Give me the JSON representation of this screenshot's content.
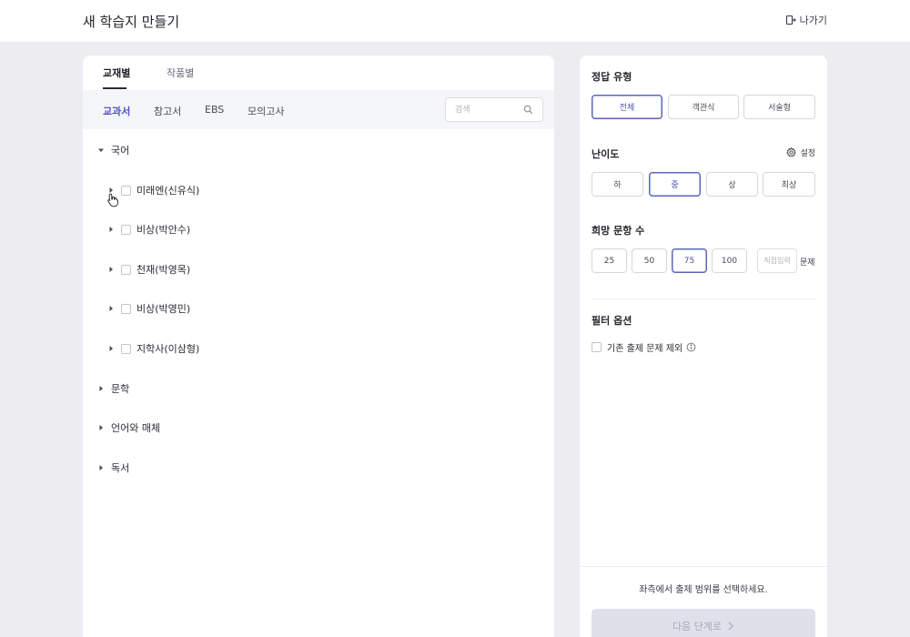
{
  "header": {
    "title": "새 학습지 만들기",
    "exit_label": "나가기"
  },
  "left": {
    "main_tabs": [
      {
        "label": "교재별"
      },
      {
        "label": "작품별"
      }
    ],
    "sub_tabs": [
      {
        "label": "교과서"
      },
      {
        "label": "참고서"
      },
      {
        "label": "EBS"
      },
      {
        "label": "모의고사"
      }
    ],
    "search": {
      "placeholder": "검색",
      "value": ""
    },
    "tree": {
      "root": {
        "label": "국어"
      },
      "children": [
        {
          "label": "미래엔(신유식)"
        },
        {
          "label": "비상(박안수)"
        },
        {
          "label": "천재(박영목)"
        },
        {
          "label": "비상(박영민)"
        },
        {
          "label": "지학사(이삼형)"
        }
      ],
      "siblings": [
        {
          "label": "문학"
        },
        {
          "label": "언어와 매체"
        },
        {
          "label": "독서"
        }
      ]
    }
  },
  "right": {
    "answer_type": {
      "title": "정답 유형",
      "options": [
        {
          "label": "전체"
        },
        {
          "label": "객관식"
        },
        {
          "label": "서술형"
        }
      ],
      "selected": "전체"
    },
    "difficulty": {
      "title": "난이도",
      "settings_label": "설정",
      "options": [
        {
          "label": "하"
        },
        {
          "label": "중"
        },
        {
          "label": "상"
        },
        {
          "label": "최상"
        }
      ],
      "selected": "중"
    },
    "count": {
      "title": "희망 문항 수",
      "options": [
        {
          "label": "25"
        },
        {
          "label": "50"
        },
        {
          "label": "75"
        },
        {
          "label": "100"
        }
      ],
      "selected": "75",
      "direct_placeholder": "직접입력",
      "unit": "문제"
    },
    "filter": {
      "title": "필터 옵션",
      "exclude_label": "기존 출제 문제 제외"
    },
    "footer": {
      "message": "좌측에서 출제 범위를 선택하세요.",
      "next_label": "다음 단계로"
    }
  },
  "colors": {
    "accent": "#4f52c9",
    "selected_border": "#5a66b8",
    "disabled_button": "#dfe0ea",
    "page_bg": "#ececf1"
  }
}
